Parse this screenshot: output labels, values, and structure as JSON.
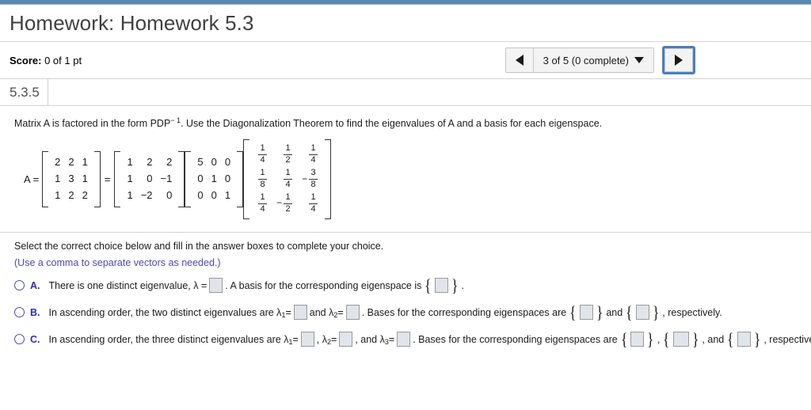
{
  "header": {
    "title": "Homework: Homework 5.3",
    "score_label": "Score:",
    "score_value": "0 of 1 pt",
    "problem_id": "5.3.5"
  },
  "nav": {
    "prev_icon": "triangle-left-icon",
    "next_icon": "triangle-right-icon",
    "dropdown_icon": "triangle-down-icon",
    "position_label": "3 of 5 (0 complete)",
    "focus_color": "#4a7ebb"
  },
  "question": {
    "text_before": "Matrix A is factored in the form PDP",
    "exponent": "− 1",
    "text_after": ". Use the Diagonalization Theorem to find the eigenvalues of A and a basis for each eigenspace.",
    "a_label": "A =",
    "equals": "=",
    "matrix_a": [
      [
        "2",
        "2",
        "1"
      ],
      [
        "1",
        "3",
        "1"
      ],
      [
        "1",
        "2",
        "2"
      ]
    ],
    "matrix_p": [
      [
        "1",
        "2",
        "2"
      ],
      [
        "1",
        "0",
        "−1"
      ],
      [
        "1",
        "−2",
        "0"
      ]
    ],
    "matrix_d": [
      [
        "5",
        "0",
        "0"
      ],
      [
        "0",
        "1",
        "0"
      ],
      [
        "0",
        "0",
        "1"
      ]
    ],
    "matrix_pinv": [
      [
        {
          "neg": "",
          "num": "1",
          "den": "4"
        },
        {
          "neg": "",
          "num": "1",
          "den": "2"
        },
        {
          "neg": "",
          "num": "1",
          "den": "4"
        }
      ],
      [
        {
          "neg": "",
          "num": "1",
          "den": "8"
        },
        {
          "neg": "",
          "num": "1",
          "den": "4"
        },
        {
          "neg": "−",
          "num": "3",
          "den": "8"
        }
      ],
      [
        {
          "neg": "",
          "num": "1",
          "den": "4"
        },
        {
          "neg": "−",
          "num": "1",
          "den": "2"
        },
        {
          "neg": "",
          "num": "1",
          "den": "4"
        }
      ]
    ]
  },
  "choices_intro": {
    "select_line": "Select the correct choice below and fill in the answer boxes to complete your choice.",
    "hint_line": "(Use a comma to separate vectors as needed.)",
    "hint_color": "#4a4ab5"
  },
  "choices": [
    {
      "letter": "A.",
      "seg1": "There is one distinct eigenvalue, λ =",
      "seg2": ". A basis for the corresponding eigenspace is",
      "seg3": "."
    },
    {
      "letter": "B.",
      "seg1": "In ascending order, the two distinct eigenvalues are λ",
      "sub1": "1",
      "seg2": "=",
      "seg3": "and λ",
      "sub2": "2",
      "seg4": "=",
      "seg5": ". Bases for the corresponding eigenspaces are",
      "seg6": "and",
      "seg7": ", respectively."
    },
    {
      "letter": "C.",
      "seg1": "In ascending order, the three distinct eigenvalues are λ",
      "sub1": "1",
      "seg2": "=",
      "seg3": ", λ",
      "sub2": "2",
      "seg4": "=",
      "seg5": ", and λ",
      "sub3": "3",
      "seg6": "=",
      "seg7": ". Bases for the corresponding eigenspaces are",
      "seg8": ",",
      "seg9": ", and",
      "seg10": ", respectively."
    }
  ]
}
